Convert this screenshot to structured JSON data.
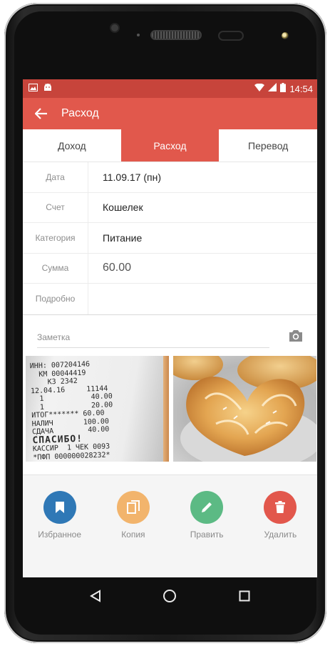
{
  "statusbar": {
    "time": "14:54"
  },
  "appbar": {
    "title": "Расход"
  },
  "tabs": [
    {
      "label": "Доход",
      "active": false
    },
    {
      "label": "Расход",
      "active": true
    },
    {
      "label": "Перевод",
      "active": false
    }
  ],
  "form": {
    "date": {
      "label": "Дата",
      "value": "11.09.17 (пн)"
    },
    "account": {
      "label": "Счет",
      "value": "Кошелек"
    },
    "category": {
      "label": "Категория",
      "value": "Питание"
    },
    "amount": {
      "label": "Сумма",
      "value": "60.00"
    },
    "details": {
      "label": "Подробно",
      "value": ""
    }
  },
  "note": {
    "placeholder": "Заметка"
  },
  "receipt": {
    "lines": [
      "ИНН: 007204146",
      "  КМ 00044419",
      "    КЗ 2342",
      "12.04.16     11144",
      "  1           40.00",
      "  1           20.00",
      "ИТОГ******* 60.00",
      "НАЛИЧ       100.00",
      "СДАЧА        40.00"
    ],
    "thanks": "СПАСИБО!",
    "cashier": "КАССИР  1 ЧЕК 0093",
    "fiscal": "*ПФП 000000028232*"
  },
  "actions": [
    {
      "label": "Избранное",
      "color": "#2f78b6",
      "icon": "bookmark-icon"
    },
    {
      "label": "Копия",
      "color": "#f2b46c",
      "icon": "copy-icon"
    },
    {
      "label": "Править",
      "color": "#5cba84",
      "icon": "pencil-icon"
    },
    {
      "label": "Удалить",
      "color": "#e2574c",
      "icon": "trash-icon"
    }
  ],
  "colors": {
    "statusbar": "#c7443b",
    "appbar": "#e1584c",
    "active_tab": "#e1584c"
  }
}
